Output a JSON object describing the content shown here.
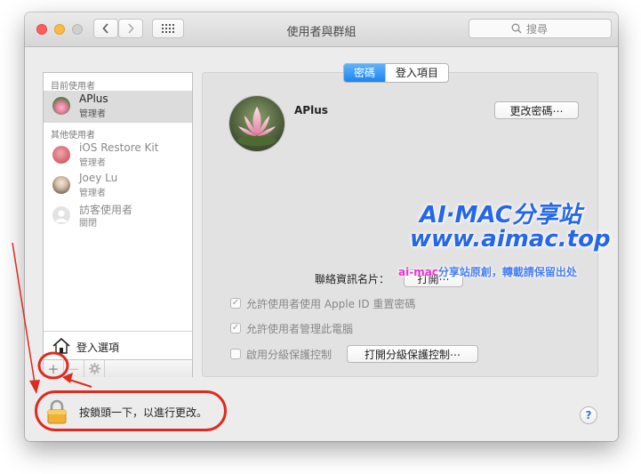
{
  "window": {
    "title": "使用者與群組"
  },
  "toolbar": {
    "back_glyph": "‹",
    "forward_glyph": "›",
    "grid_icon": "grid-icon"
  },
  "search": {
    "placeholder": "搜尋"
  },
  "sidebar": {
    "current_header": "目前使用者",
    "other_header": "其他使用者",
    "users": [
      {
        "name": "APlus",
        "role": "管理者",
        "selected": true
      },
      {
        "name": "iOS Restore Kit",
        "role": "管理者"
      },
      {
        "name": "Joey Lu",
        "role": "管理者"
      },
      {
        "name": "訪客使用者",
        "role": "關閉"
      }
    ],
    "login_options": "登入選項",
    "add_glyph": "+",
    "remove_glyph": "−"
  },
  "tabs": {
    "password": "密碼",
    "login_items": "登入項目"
  },
  "detail": {
    "user_name": "APlus",
    "change_password": "更改密碼⋯",
    "contact_card_label": "聯絡資訊名片：",
    "open_button": "打開⋯",
    "checkbox_appleid": "允許使用者使用 Apple ID 重置密碼",
    "checkbox_admin": "允許使用者管理此電腦",
    "checkbox_parental": "啟用分級保護控制",
    "parental_button": "打開分級保護控制⋯",
    "check_mark": "✓"
  },
  "watermark": {
    "line1": "AI·MAC分享站",
    "line2": "www.aimac.top",
    "line3a": "ai-mac",
    "line3b": "分享站原創，轉載請保留出处"
  },
  "lock": {
    "text": "按鎖頭一下，以進行更改。"
  },
  "help": {
    "label": "?"
  },
  "colors": {
    "accent": "#1b84f1",
    "annotation": "#e02a1e",
    "watermark": "#2567e8"
  }
}
